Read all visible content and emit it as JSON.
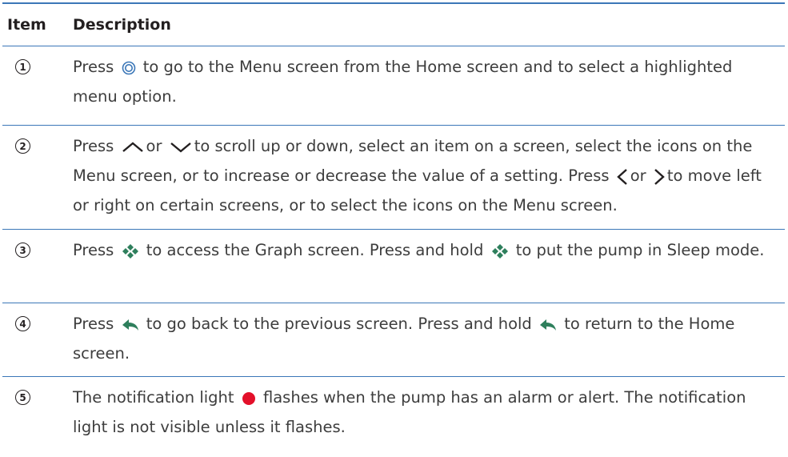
{
  "table": {
    "col_item": "Item",
    "col_description": "Description",
    "rows": [
      {
        "num": "1",
        "p1": "Press",
        "p2": "to go to the Menu screen from the Home screen and to select a highlighted menu option."
      },
      {
        "num": "2",
        "p1": "Press",
        "p2": "or",
        "p3": "to scroll up or down, select an item on a screen, select the icons on the Menu screen, or to increase or decrease the value of a setting. Press",
        "p4": "or",
        "p5": "to move left or right on certain screens, or to select the icons on the Menu screen."
      },
      {
        "num": "3",
        "p1": "Press",
        "p2": "to access the Graph screen. Press and hold",
        "p3": "to put the pump in Sleep mode."
      },
      {
        "num": "4",
        "p1": "Press",
        "p2": "to go back to the previous screen. Press and hold",
        "p3": "to return to the Home screen."
      },
      {
        "num": "5",
        "p1": "The notification light",
        "p2": "flashes when the pump has an alarm or alert. The notification light is not visible unless it flashes."
      }
    ]
  },
  "icons": {
    "select": "select-button-icon",
    "up": "up-arrow-icon",
    "down": "down-arrow-icon",
    "left": "left-arrow-icon",
    "right": "right-arrow-icon",
    "graph": "graph-diamond-icon",
    "back": "back-arrow-icon",
    "light": "notification-light-icon"
  },
  "colors": {
    "rule": "#3b77b8",
    "notification_light": "#e3102a"
  }
}
